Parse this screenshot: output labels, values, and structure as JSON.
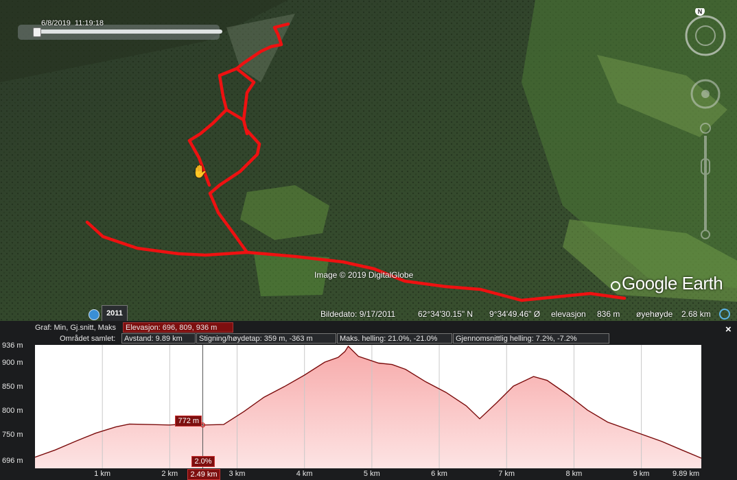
{
  "map": {
    "time_slider_label": "6/8/2019  11:19:18",
    "image_credit": "Image © 2019 DigitalGlobe",
    "logo_text": "Google Earth",
    "imagery_year_button": "2011",
    "compass_label": "N",
    "track_color": "#ee1111",
    "status": {
      "image_date": "Bildedato: 9/17/2011",
      "latitude": "62°34'30.15\" N",
      "longitude": "9°34'49.46\" Ø",
      "elevation_label": "elevasjon",
      "elevation_value": "836 m",
      "eye_alt_label": "øyehøyde",
      "eye_alt_value": "2.68 km"
    }
  },
  "profile": {
    "close_label": "×",
    "graph_label": "Graf: Min, Gj.snitt, Maks",
    "elevation_box": "Elevasjon: 696, 809, 936 m",
    "area_label": "Området samlet:",
    "distance_box": "Avstand: 9.89 km",
    "climb_box": "Stigning/høydetap: 359 m, -363 m",
    "max_slope_box": "Maks. helling: 21.0%, -21.0%",
    "avg_slope_box": "Gjennomsnittlig helling: 7.2%, -7.2%",
    "fill_color": "#f7a9a9",
    "line_color": "#7a0b0b",
    "cursor_elevation": "772 m",
    "cursor_slope": "2.0%",
    "cursor_distance": "2.49 km",
    "y_tick_labels": [
      "936 m",
      "900 m",
      "850 m",
      "800 m",
      "750 m",
      "696 m"
    ],
    "x_tick_labels": [
      "1 km",
      "2 km",
      "3 km",
      "4 km",
      "5 km",
      "6 km",
      "7 km",
      "8 km",
      "9 km",
      "9.89 km"
    ]
  },
  "chart_data": {
    "type": "area",
    "xlabel": "",
    "ylabel": "",
    "xlim": [
      0,
      9.89
    ],
    "ylim": [
      696,
      936
    ],
    "x_unit": "km",
    "y_unit": "m",
    "x": [
      0,
      0.3,
      0.6,
      0.9,
      1.2,
      1.4,
      1.7,
      2.0,
      2.2,
      2.35,
      2.49,
      2.8,
      3.1,
      3.4,
      3.7,
      4.0,
      4.3,
      4.5,
      4.6,
      4.65,
      4.8,
      5.1,
      5.3,
      5.5,
      5.8,
      6.1,
      6.4,
      6.6,
      6.85,
      7.1,
      7.4,
      7.6,
      7.9,
      8.2,
      8.5,
      8.9,
      9.3,
      9.6,
      9.89
    ],
    "y": [
      705,
      720,
      738,
      755,
      768,
      774,
      773,
      772,
      774,
      781,
      772,
      773,
      800,
      830,
      852,
      876,
      903,
      913,
      925,
      936,
      915,
      901,
      898,
      888,
      862,
      840,
      812,
      785,
      818,
      853,
      873,
      865,
      836,
      803,
      778,
      758,
      738,
      720,
      703
    ],
    "grid": true,
    "fill": true
  }
}
